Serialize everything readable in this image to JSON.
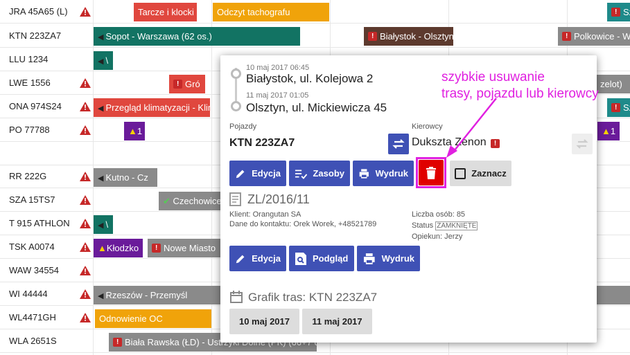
{
  "vehicles": [
    {
      "name": "JRA 45A65 (L)",
      "warn": true
    },
    {
      "name": "KTN 223ZA7",
      "warn": false
    },
    {
      "name": "LLU 1234",
      "warn": false
    },
    {
      "name": "LWE 1556",
      "warn": true
    },
    {
      "name": "ONA 974S24",
      "warn": true
    },
    {
      "name": "PO 77788",
      "warn": true
    },
    {
      "name": "RR 222G",
      "warn": true
    },
    {
      "name": "SZA 15TS7",
      "warn": true
    },
    {
      "name": "T 915 ATHLON",
      "warn": true
    },
    {
      "name": "TSK A0074",
      "warn": true
    },
    {
      "name": "WAW 34554",
      "warn": true
    },
    {
      "name": "WI 44444",
      "warn": true
    },
    {
      "name": "WL4471GH",
      "warn": true
    },
    {
      "name": "WLA 2651S",
      "warn": false
    }
  ],
  "events": {
    "e1": "Tarcze i klocki",
    "e2": "Odczyt tachografu",
    "e3": "Sz",
    "e4": "Sopot - Warszawa (62 os.)",
    "e5": "Białystok - Olsztyn",
    "e6": "Polkowice - Wa",
    "e7": "\\",
    "e8": "Gró",
    "e9": "zelot)",
    "e10": "Przegląd klimatyzacji - Klimatyzacja",
    "e11": "Sz",
    "e12": "1",
    "e13": "1",
    "e14": "Kutno - Cz",
    "e15": "Czechowice",
    "e16": "\\",
    "e17": "Kłodzko",
    "e18": "Nowe Miasto",
    "e19": "Rzeszów - Przemyśl",
    "e20": "Odnowienie OC",
    "e21": "Biała Rawska (ŁD) - Ustrzyki Dolne (PK) (66+7 o"
  },
  "popup": {
    "start_time": "10 maj 2017 06:45",
    "start_addr": "Białystok, ul. Kolejowa 2",
    "end_time": "11 maj 2017 01:05",
    "end_addr": "Olsztyn, ul. Mickiewicza 45",
    "vehicle_label": "Pojazdy",
    "vehicle": "KTN 223ZA7",
    "driver_label": "Kierowcy",
    "driver": "Dukszta Zenon",
    "btn_edit": "Edycja",
    "btn_resources": "Zasoby",
    "btn_print": "Wydruk",
    "btn_select": "Zaznacz",
    "order_no": "ZL/2016/11",
    "client": "Klient: Orangutan SA",
    "contact": "Dane do kontaktu: Orek Worek, +48521789",
    "persons": "Liczba osób: 85",
    "status_label": "Status",
    "status": "ZAMKNIĘTE",
    "guardian": "Opiekun: Jerzy",
    "btn_edit2": "Edycja",
    "btn_preview": "Podgląd",
    "btn_print2": "Wydruk",
    "schedule_title": "Grafik tras: KTN 223ZA7",
    "date1": "10 maj 2017",
    "date2": "11 maj 2017"
  },
  "annotation": {
    "line1": "szybkie usuwanie",
    "line2": "trasy, pojazdu lub kierowcy"
  },
  "colors": {
    "accent": "#3f51b5",
    "delete": "#e00000",
    "highlight": "#e020e0"
  }
}
